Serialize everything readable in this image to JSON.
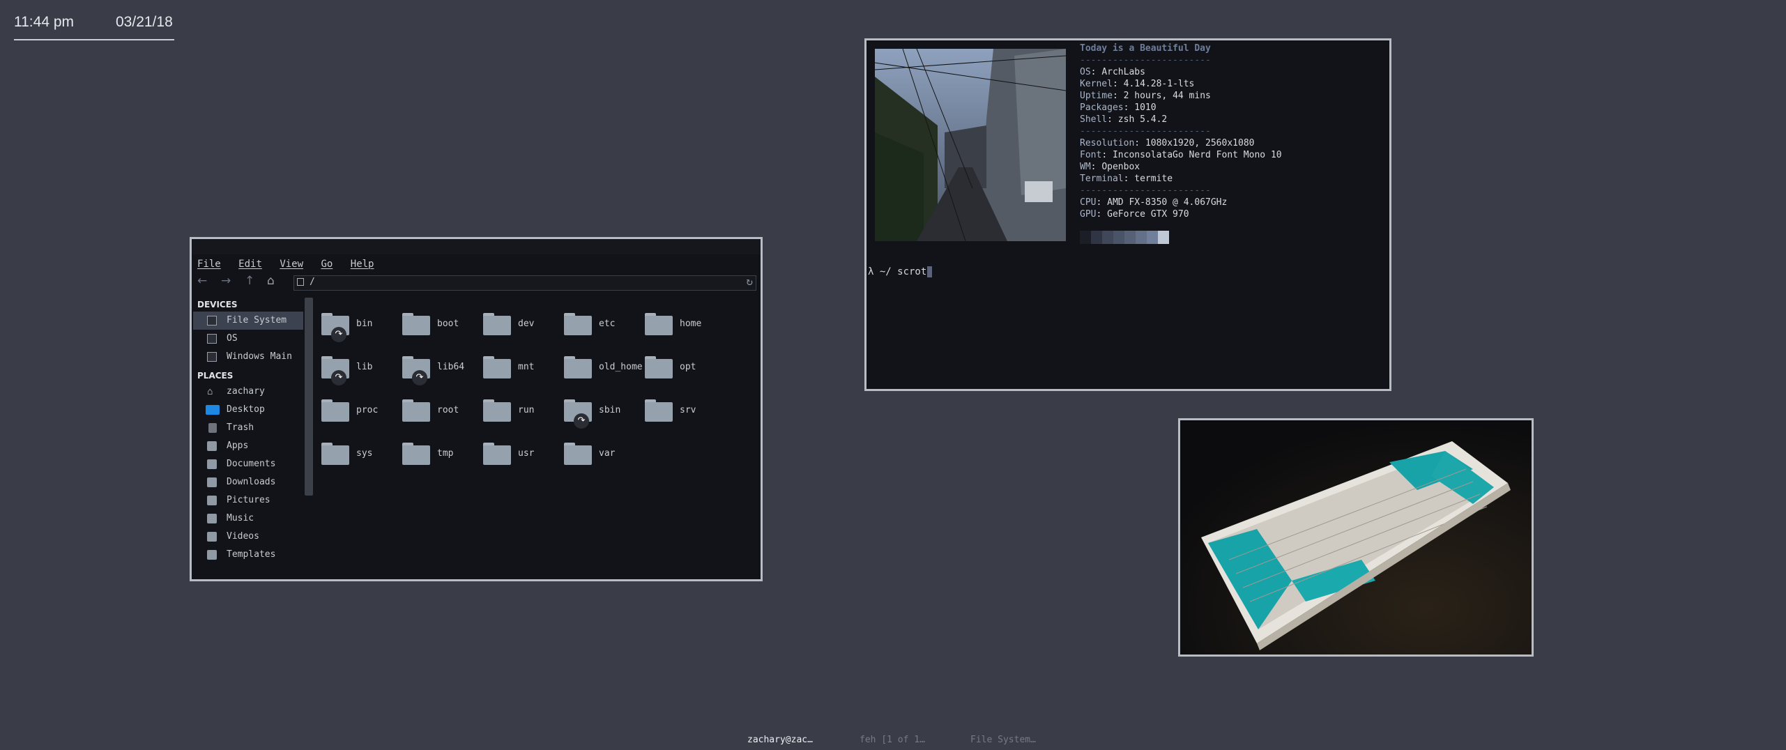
{
  "clock": {
    "time": "11:44 pm",
    "date": "03/21/18"
  },
  "file_manager": {
    "menu": [
      "File",
      "Edit",
      "View",
      "Go",
      "Help"
    ],
    "path": "/",
    "sidebar": {
      "devices_heading": "DEVICES",
      "devices": [
        {
          "label": "File System",
          "selected": true,
          "icon": "drive-icon"
        },
        {
          "label": "OS",
          "selected": false,
          "icon": "drive-icon"
        },
        {
          "label": "Windows Main",
          "selected": false,
          "icon": "drive-icon"
        }
      ],
      "places_heading": "PLACES",
      "places": [
        {
          "label": "zachary",
          "icon": "home-icon"
        },
        {
          "label": "Desktop",
          "icon": "desktop-icon"
        },
        {
          "label": "Trash",
          "icon": "trash-icon"
        },
        {
          "label": "Apps",
          "icon": "folder-icon"
        },
        {
          "label": "Documents",
          "icon": "folder-icon"
        },
        {
          "label": "Downloads",
          "icon": "folder-icon"
        },
        {
          "label": "Pictures",
          "icon": "folder-icon"
        },
        {
          "label": "Music",
          "icon": "folder-icon"
        },
        {
          "label": "Videos",
          "icon": "folder-icon"
        },
        {
          "label": "Templates",
          "icon": "folder-icon"
        }
      ]
    },
    "folders": [
      {
        "name": "bin",
        "symlink": true
      },
      {
        "name": "boot",
        "symlink": false
      },
      {
        "name": "dev",
        "symlink": false
      },
      {
        "name": "etc",
        "symlink": false
      },
      {
        "name": "home",
        "symlink": false
      },
      {
        "name": "lib",
        "symlink": true
      },
      {
        "name": "lib64",
        "symlink": true
      },
      {
        "name": "mnt",
        "symlink": false
      },
      {
        "name": "old_home",
        "symlink": false
      },
      {
        "name": "opt",
        "symlink": false
      },
      {
        "name": "proc",
        "symlink": false
      },
      {
        "name": "root",
        "symlink": false
      },
      {
        "name": "run",
        "symlink": false
      },
      {
        "name": "sbin",
        "symlink": true
      },
      {
        "name": "srv",
        "symlink": false
      },
      {
        "name": "sys",
        "symlink": false
      },
      {
        "name": "tmp",
        "symlink": false
      },
      {
        "name": "usr",
        "symlink": false
      },
      {
        "name": "var",
        "symlink": false
      }
    ]
  },
  "terminal": {
    "title": "Today is a Beautiful Day",
    "separator": "------------------------",
    "info1": [
      {
        "key": "OS",
        "value": "ArchLabs"
      },
      {
        "key": "Kernel",
        "value": "4.14.28-1-lts"
      },
      {
        "key": "Uptime",
        "value": "2 hours, 44 mins"
      },
      {
        "key": "Packages",
        "value": "1010"
      },
      {
        "key": "Shell",
        "value": "zsh 5.4.2"
      }
    ],
    "info2": [
      {
        "key": "Resolution",
        "value": "1080x1920, 2560x1080"
      },
      {
        "key": "Font",
        "value": "InconsolataGo Nerd Font Mono 10"
      },
      {
        "key": "WM",
        "value": "Openbox"
      },
      {
        "key": "Terminal",
        "value": "termite"
      }
    ],
    "info3": [
      {
        "key": "CPU",
        "value": "AMD FX-8350 @ 4.067GHz"
      },
      {
        "key": "GPU",
        "value": "GeForce GTX 970"
      }
    ],
    "palette": [
      "#1b1e26",
      "#2f3544",
      "#3f4759",
      "#4a5468",
      "#566176",
      "#637087",
      "#71809a",
      "#bfc8d4"
    ],
    "prompt": "λ ~/ scrot"
  },
  "taskbar": [
    {
      "label": "zachary@zac…",
      "active": true
    },
    {
      "label": "feh [1 of 1…",
      "active": false
    },
    {
      "label": "File System…",
      "active": false
    }
  ]
}
